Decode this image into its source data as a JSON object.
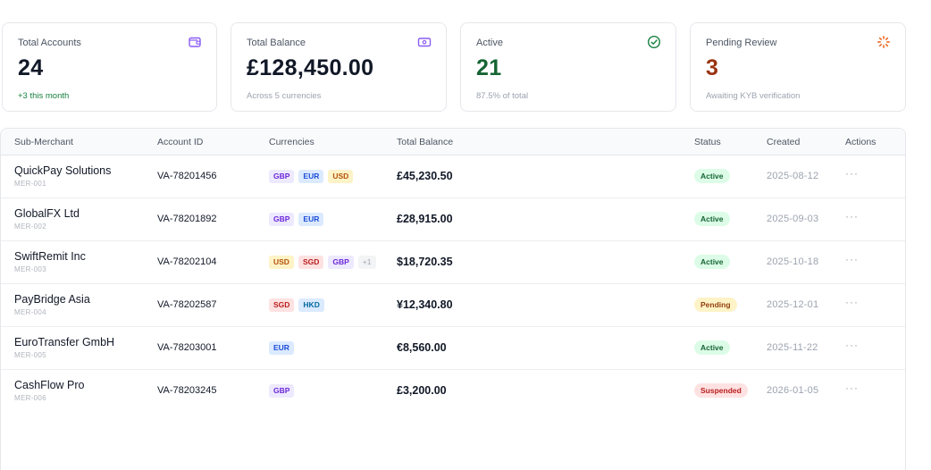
{
  "colors": {
    "accent_purple": "#8b5cf6",
    "active_green": "#166534",
    "pending_brown": "#9a3412",
    "border": "#e5e7eb"
  },
  "summary": {
    "total_accounts": {
      "label": "Total Accounts",
      "value": "24",
      "sub": "+3 this month",
      "icon": "wallet-icon"
    },
    "total_balance": {
      "label": "Total Balance",
      "value": "£128,450.00",
      "sub": "Across 5 currencies",
      "icon": "banknote-icon"
    },
    "active": {
      "label": "Active",
      "value": "21",
      "sub": "87.5% of total",
      "icon": "check-circle-icon"
    },
    "pending_review": {
      "label": "Pending Review",
      "value": "3",
      "sub": "Awaiting KYB verification",
      "icon": "loader-icon"
    }
  },
  "table": {
    "headers": {
      "sub_merchant": "Sub-Merchant",
      "account_id": "Account ID",
      "currencies": "Currencies",
      "total_balance": "Total Balance",
      "status": "Status",
      "created": "Created",
      "actions": "Actions"
    },
    "rows": [
      {
        "name": "QuickPay Solutions",
        "merchant_id": "MER-001",
        "account_id": "VA-78201456",
        "currencies": [
          "GBP",
          "EUR",
          "USD"
        ],
        "more": "",
        "balance": "£45,230.50",
        "status": "Active",
        "created": "2025-08-12",
        "actions": "···"
      },
      {
        "name": "GlobalFX Ltd",
        "merchant_id": "MER-002",
        "account_id": "VA-78201892",
        "currencies": [
          "GBP",
          "EUR"
        ],
        "more": "",
        "balance": "£28,915.00",
        "status": "Active",
        "created": "2025-09-03",
        "actions": "···"
      },
      {
        "name": "SwiftRemit Inc",
        "merchant_id": "MER-003",
        "account_id": "VA-78202104",
        "currencies": [
          "USD",
          "SGD",
          "GBP"
        ],
        "more": "+1",
        "balance": "$18,720.35",
        "status": "Active",
        "created": "2025-10-18",
        "actions": "···"
      },
      {
        "name": "PayBridge Asia",
        "merchant_id": "MER-004",
        "account_id": "VA-78202587",
        "currencies": [
          "SGD",
          "HKD"
        ],
        "more": "",
        "balance": "¥12,340.80",
        "status": "Pending",
        "created": "2025-12-01",
        "actions": "···"
      },
      {
        "name": "EuroTransfer GmbH",
        "merchant_id": "MER-005",
        "account_id": "VA-78203001",
        "currencies": [
          "EUR"
        ],
        "more": "",
        "balance": "€8,560.00",
        "status": "Active",
        "created": "2025-11-22",
        "actions": "···"
      },
      {
        "name": "CashFlow Pro",
        "merchant_id": "MER-006",
        "account_id": "VA-78203245",
        "currencies": [
          "GBP"
        ],
        "more": "",
        "balance": "£3,200.00",
        "status": "Suspended",
        "created": "2026-01-05",
        "actions": "···"
      }
    ]
  }
}
